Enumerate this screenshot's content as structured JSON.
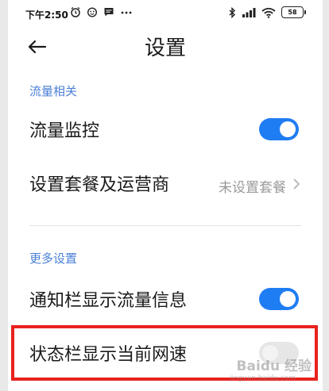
{
  "status_bar": {
    "time": "下午2:50",
    "left_icons": [
      "alarm-icon",
      "face-icon",
      "message-icon",
      "more-dots-icon"
    ],
    "right_icons": [
      "bluetooth-icon",
      "signal-icon",
      "wifi-icon"
    ],
    "battery": "58"
  },
  "header": {
    "back_icon": "arrow-left-icon",
    "title": "设置"
  },
  "sections": [
    {
      "label": "流量相关",
      "items": [
        {
          "label": "流量监控",
          "control": "toggle",
          "on": true
        },
        {
          "label": "设置套餐及运营商",
          "value": "未设置套餐",
          "control": "chevron"
        }
      ]
    },
    {
      "label": "更多设置",
      "items": [
        {
          "label": "通知栏显示流量信息",
          "control": "toggle",
          "on": true
        },
        {
          "label": "状态栏显示当前网速",
          "control": "toggle",
          "on": false
        }
      ]
    }
  ],
  "watermark": {
    "brand": "Baidu 经验",
    "url": "jingyan.baidu.com"
  },
  "colors": {
    "accent": "#1f7df4",
    "section_label": "#4a7fd6",
    "highlight": "#e8221e"
  }
}
